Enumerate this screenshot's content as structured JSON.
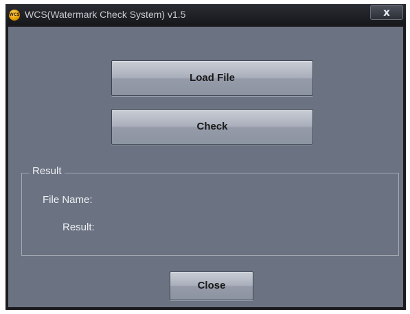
{
  "window": {
    "title": "WCS(Watermark Check System) v1.5",
    "app_icon": "wcs-logo-icon",
    "app_icon_text": "WCS",
    "close_glyph": "x"
  },
  "actions": {
    "load_file_label": "Load File",
    "check_label": "Check",
    "close_label": "Close"
  },
  "result_group": {
    "title": "Result",
    "file_name_label": "File Name:",
    "result_label": "Result:"
  },
  "colors": {
    "titlebar": "#1b1b1f",
    "client_background": "#6b7281",
    "button_face": "#a9afbb",
    "label_text": "#eef0f4"
  }
}
